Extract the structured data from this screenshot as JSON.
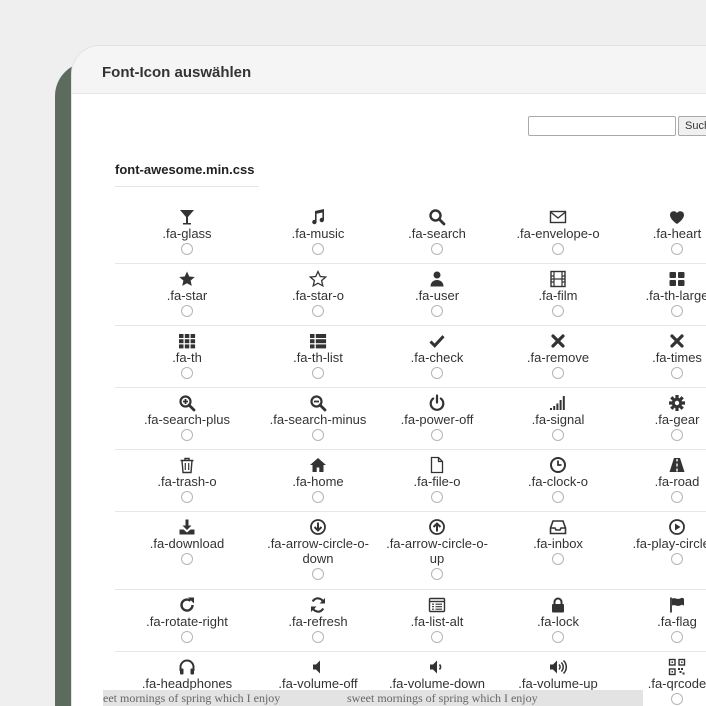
{
  "dialog": {
    "title": "Font-Icon auswählen",
    "search_placeholder": "",
    "search_button_label": "Suchen"
  },
  "section": {
    "title": "font-awesome.min.css"
  },
  "icons": [
    [
      "glass",
      ".fa-glass"
    ],
    [
      "music",
      ".fa-music"
    ],
    [
      "search",
      ".fa-search"
    ],
    [
      "envelope",
      ".fa-envelope-o"
    ],
    [
      "heart",
      ".fa-heart"
    ],
    [
      "star",
      ".fa-star"
    ],
    [
      "star-o",
      ".fa-star-o"
    ],
    [
      "user",
      ".fa-user"
    ],
    [
      "film",
      ".fa-film"
    ],
    [
      "th-large",
      ".fa-th-large"
    ],
    [
      "th",
      ".fa-th"
    ],
    [
      "th-list",
      ".fa-th-list"
    ],
    [
      "check",
      ".fa-check"
    ],
    [
      "remove",
      ".fa-remove"
    ],
    [
      "times",
      ".fa-times"
    ],
    [
      "search-plus",
      ".fa-search-plus"
    ],
    [
      "search-minus",
      ".fa-search-minus"
    ],
    [
      "power-off",
      ".fa-power-off"
    ],
    [
      "signal",
      ".fa-signal"
    ],
    [
      "gear",
      ".fa-gear"
    ],
    [
      "trash",
      ".fa-trash-o"
    ],
    [
      "home",
      ".fa-home"
    ],
    [
      "file",
      ".fa-file-o"
    ],
    [
      "clock",
      ".fa-clock-o"
    ],
    [
      "road",
      ".fa-road"
    ],
    [
      "download",
      ".fa-download"
    ],
    [
      "arrow-down",
      ".fa-arrow-circle-o-down"
    ],
    [
      "arrow-up",
      ".fa-arrow-circle-o-up"
    ],
    [
      "inbox",
      ".fa-inbox"
    ],
    [
      "play",
      ".fa-play-circle-o"
    ],
    [
      "rotate",
      ".fa-rotate-right"
    ],
    [
      "refresh",
      ".fa-refresh"
    ],
    [
      "list-alt",
      ".fa-list-alt"
    ],
    [
      "lock",
      ".fa-lock"
    ],
    [
      "flag",
      ".fa-flag"
    ],
    [
      "headphones",
      ".fa-headphones"
    ],
    [
      "volume-off",
      ".fa-volume-off"
    ],
    [
      "volume-down",
      ".fa-volume-down"
    ],
    [
      "volume-up",
      ".fa-volume-up"
    ],
    [
      "qrcode",
      ".fa-qrcode"
    ]
  ],
  "footer": {
    "ticker_left": "eet mornings of spring which I enjoy",
    "ticker_right": "sweet mornings of spring which I enjoy"
  }
}
